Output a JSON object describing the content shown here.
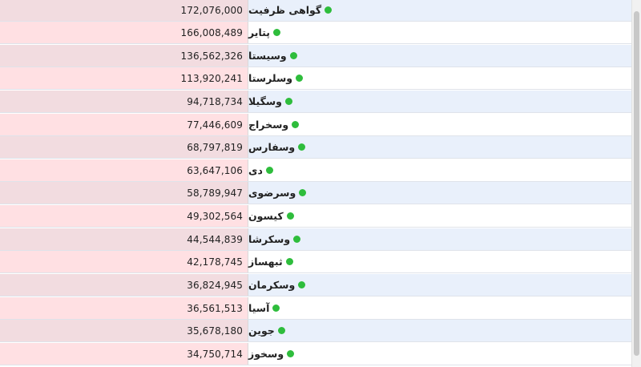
{
  "colors": {
    "value_bg_odd": "#f2dce0",
    "value_bg_even": "#ffe0e3",
    "name_bg_odd": "#e9f0fb",
    "name_bg_even": "#ffffff",
    "status_dot": "#2ebd3c"
  },
  "rows": [
    {
      "name": "گواهی ظرفیت",
      "value": "172,076,000",
      "icon": "green-dot-icon"
    },
    {
      "name": "پتایر",
      "value": "166,008,489",
      "icon": "green-dot-icon"
    },
    {
      "name": "وسیستا",
      "value": "136,562,326",
      "icon": "green-dot-icon"
    },
    {
      "name": "وسلرستا",
      "value": "113,920,241",
      "icon": "green-dot-icon"
    },
    {
      "name": "وسگیلا",
      "value": "94,718,734",
      "icon": "green-dot-icon"
    },
    {
      "name": "وسخراج",
      "value": "77,446,609",
      "icon": "green-dot-icon"
    },
    {
      "name": "وسفارس",
      "value": "68,797,819",
      "icon": "green-dot-icon"
    },
    {
      "name": "دی",
      "value": "63,647,106",
      "icon": "green-dot-icon"
    },
    {
      "name": "وسرضوی",
      "value": "58,789,947",
      "icon": "green-dot-icon"
    },
    {
      "name": "کیسون",
      "value": "49,302,564",
      "icon": "green-dot-icon"
    },
    {
      "name": "وسکرشا",
      "value": "44,544,839",
      "icon": "green-dot-icon"
    },
    {
      "name": "ثبهساز",
      "value": "42,178,745",
      "icon": "green-dot-icon"
    },
    {
      "name": "وسکرمان",
      "value": "36,824,945",
      "icon": "green-dot-icon"
    },
    {
      "name": "آسیا",
      "value": "36,561,513",
      "icon": "green-dot-icon"
    },
    {
      "name": "جوین",
      "value": "35,678,180",
      "icon": "green-dot-icon"
    },
    {
      "name": "وسخوز",
      "value": "34,750,714",
      "icon": "green-dot-icon"
    }
  ]
}
